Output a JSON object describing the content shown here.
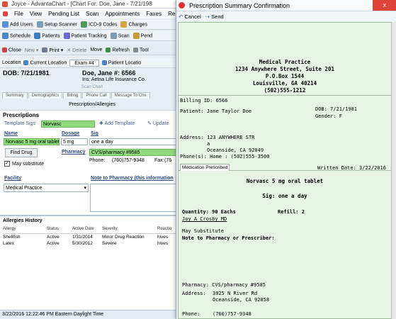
{
  "bg": {
    "title": "Joyce - AdvantaChart - [Chart For: Doe, Jane - 7/21/198",
    "menu": [
      "File",
      "View",
      "Pending List",
      "Scan",
      "Appointments",
      "Faxes",
      "Re"
    ],
    "tb1": [
      "Add Users",
      "Setup Scanner",
      "ICD-9 Codes",
      "Charges"
    ],
    "tb2": [
      "Schedule",
      "Patients",
      "Patient Tracking",
      "Scan",
      "Pend"
    ],
    "tb3": {
      "close": "Close",
      "new": "New",
      "print": "Print",
      "delete": "Delete",
      "move": "Move",
      "refresh": "Refresh",
      "tool": "Tool"
    },
    "loc": {
      "location": "Location",
      "current": "Current Location",
      "exam": "Exam #4",
      "patient_loc": "Patient Locatio"
    },
    "dob": "DOB: 7/21/1981",
    "patient": "Doe, Jane #: 6566",
    "insurance": "Ins: Aetna Life Insurance Co.",
    "scan_chart": "Scan Chart",
    "tabs": [
      "Summary",
      "Demographics",
      "Billing",
      "Phone Call",
      "Message To Che"
    ],
    "section_sub": "Prescription/Allergies",
    "prescriptions": "Prescriptions",
    "template_sigs": "Template Sigs",
    "template_value": "Norvasc",
    "add_template": "Add Template",
    "update": "Update",
    "name_h": "Name",
    "dosage_h": "Dosage",
    "sig_h": "Sig",
    "name_v": "Norvasc 5 mg oral tablet",
    "dosage_v": "5 mg",
    "sig_v": "one a day",
    "find_drug": "Find Drug",
    "pharmacy_h": "Pharmacy",
    "pharmacy_v": "CVS/pharmacy #9585",
    "phone_l": "Phone:",
    "phone_v": "(760)757-9348",
    "fax_l": "Fax:",
    "fax_v": "(76",
    "may_sub": "May substitute",
    "facility_h": "Facility",
    "facility_v": "Medical Practice",
    "note_h": "Note to Pharmacy (this information",
    "allergies_title": "Allergies History",
    "allergy_cols": [
      "Allergy",
      "Status",
      "Active Date",
      "Severity",
      "Reactio"
    ],
    "allergies": [
      [
        "Shellfish",
        "Active",
        "1/31/2014",
        "Minor Drug Reaction",
        "hives"
      ],
      [
        "Latex",
        "Active",
        "5/30/2012",
        "Severe",
        "hives"
      ]
    ],
    "status": "3/22/2016 12:22:46 PM Eastern Daylight Time"
  },
  "dlg": {
    "title": "Prescription Summary Confirmation",
    "close_x": "x",
    "cancel": "Cancel",
    "send": "Send",
    "practice": "Medical Practice",
    "addr1": "1234 Anywhere Street, Suite 201",
    "addr2": "P.O.Box 1544",
    "addr3": "Louisville, GA 40214",
    "phone": "(502)555-1212",
    "billing": "Billing ID: 6566",
    "patient": "Patient:  Jane Taylor Doe",
    "dob": "DOB: 7/21/1981",
    "gender": "Gender:  F",
    "address_l": "Address:",
    "address1": "123 ANYWHERE STR",
    "address2": "a",
    "address3": "Oceanside, CA 92049",
    "phones": "Phone(s): Home : (502)555-3500",
    "med_tab": "Medication Prescribed",
    "written": "Written Date: 3/22/2016",
    "drug": "Norvasc 5 mg oral tablet",
    "sig": "Sig: one a day",
    "qty": "Quantity: 90 Eachs",
    "refill": "Refill: 2",
    "prescriber": "Joy A Crosby MD",
    "maysub": "May Substitute",
    "note": "Note to Pharmacy or Prescriber:",
    "pharm": "Pharmacy: CVS/pharmacy #9585",
    "pharm_addr_l": "Address:",
    "pharm_addr1": "3925 N River Rd",
    "pharm_addr2": "Oceanside, CA 92058",
    "pharm_phone_l": "Phone:",
    "pharm_phone": "(760)757-9348"
  }
}
